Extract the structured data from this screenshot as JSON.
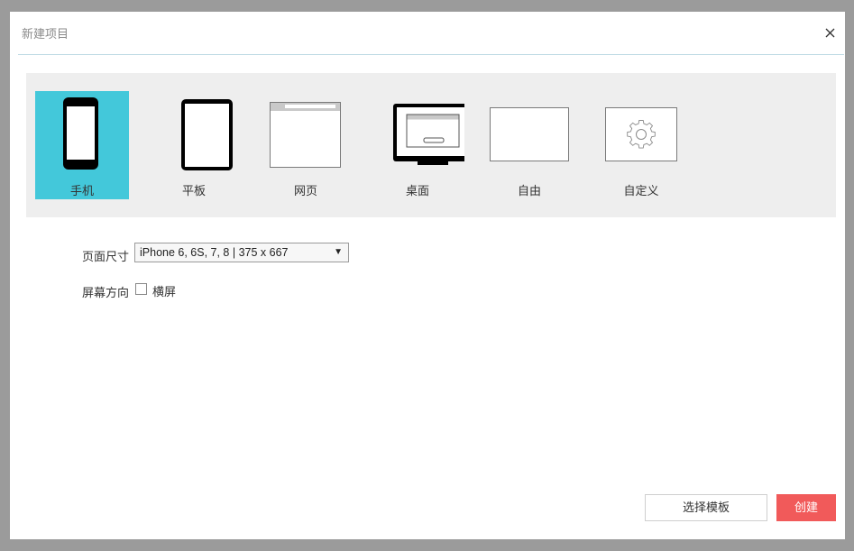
{
  "dialog": {
    "title": "新建项目",
    "close_icon": "close-icon"
  },
  "device_types": [
    {
      "label": "手机",
      "icon": "phone-icon",
      "selected": true
    },
    {
      "label": "平板",
      "icon": "tablet-icon",
      "selected": false
    },
    {
      "label": "网页",
      "icon": "webpage-icon",
      "selected": false
    },
    {
      "label": "桌面",
      "icon": "desktop-icon",
      "selected": false
    },
    {
      "label": "自由",
      "icon": "free-canvas-icon",
      "selected": false
    },
    {
      "label": "自定义",
      "icon": "gear-icon",
      "selected": false
    }
  ],
  "page_size": {
    "label": "页面尺寸",
    "value": "iPhone 6, 6S, 7, 8 | 375 x 667"
  },
  "orientation": {
    "label": "屏幕方向",
    "checkbox_label": "横屏",
    "checked": false
  },
  "buttons": {
    "template": "选择模板",
    "create": "创建"
  },
  "colors": {
    "selected_tile": "#43c8da",
    "create_button": "#f15a5a",
    "panel_bg": "#eeeeee"
  }
}
